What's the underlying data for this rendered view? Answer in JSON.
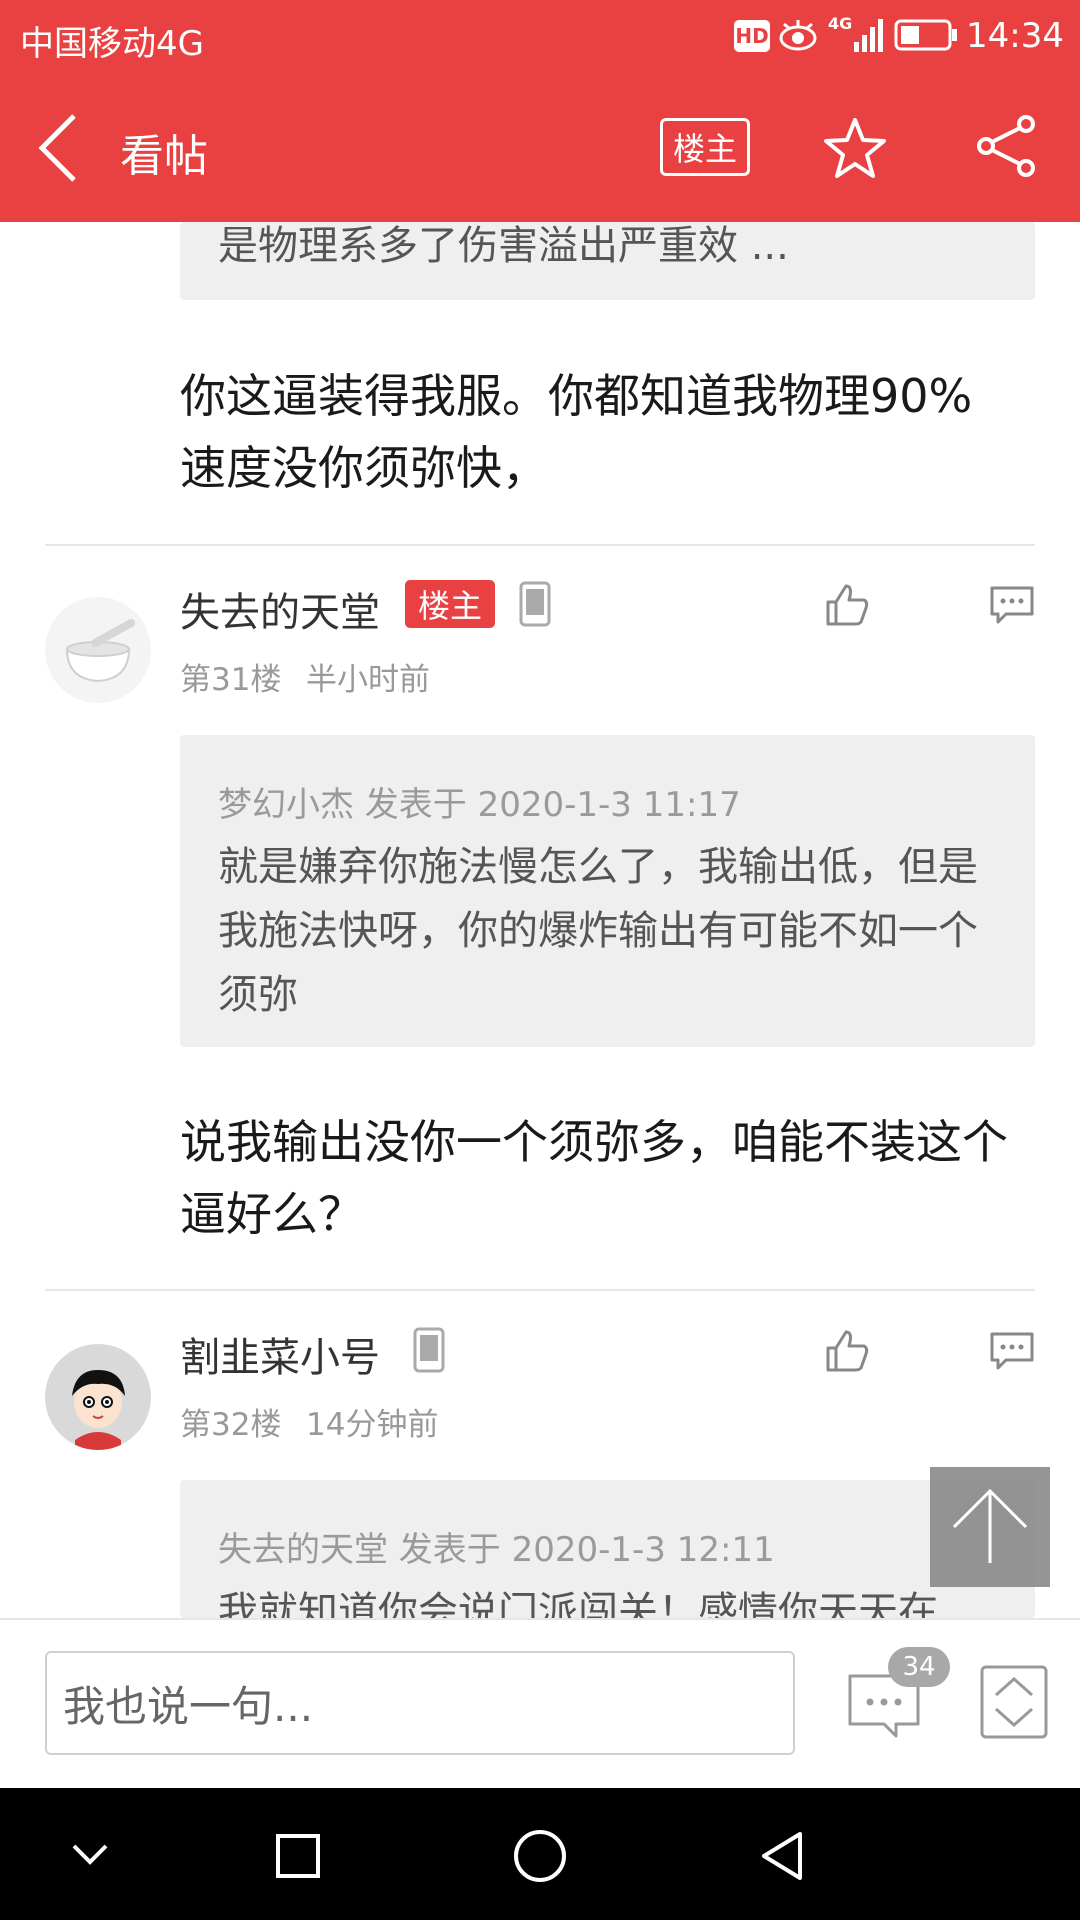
{
  "status_bar": {
    "carrier": "中国移动4G",
    "hd": "HD",
    "signal_type": "4G",
    "time": "14:34"
  },
  "header": {
    "title": "看帖",
    "louzhu_label": "楼主"
  },
  "top_partial_quote": {
    "text": "是物理系多了伤害溢出严重效 ..."
  },
  "post_30_body": "你这逼装得我服。你都知道我物理90% 速度没你须弥快，",
  "post_31": {
    "username": "失去的天堂",
    "badge": "楼主",
    "floor": "第31楼",
    "time": "半小时前",
    "quote_meta": "梦幻小杰 发表于 2020-1-3 11:17",
    "quote_text": "就是嫌弃你施法慢怎么了，我输出低，但是我施法快呀，你的爆炸输出有可能不如一个须弥",
    "body": "说我输出没你一个须弥多，咱能不装这个逼好么？"
  },
  "post_32": {
    "username": "割韭菜小号",
    "floor": "第32楼",
    "time": "14分钟前",
    "quote_meta": "失去的天堂 发表于 2020-1-3 12:11",
    "quote_text_partial": "我就知道你会说门派闯关！感情你天天在"
  },
  "bottom_bar": {
    "input_placeholder": "我也说一句...",
    "comment_count": "34"
  },
  "colors": {
    "accent": "#e94141",
    "quote_bg": "#efefef",
    "nav_bg": "#000000"
  },
  "icons": [
    "back-icon",
    "star-icon",
    "share-icon",
    "phone-icon",
    "thumb-up-icon",
    "comment-icon",
    "scroll-top-icon",
    "page-nav-icon"
  ]
}
